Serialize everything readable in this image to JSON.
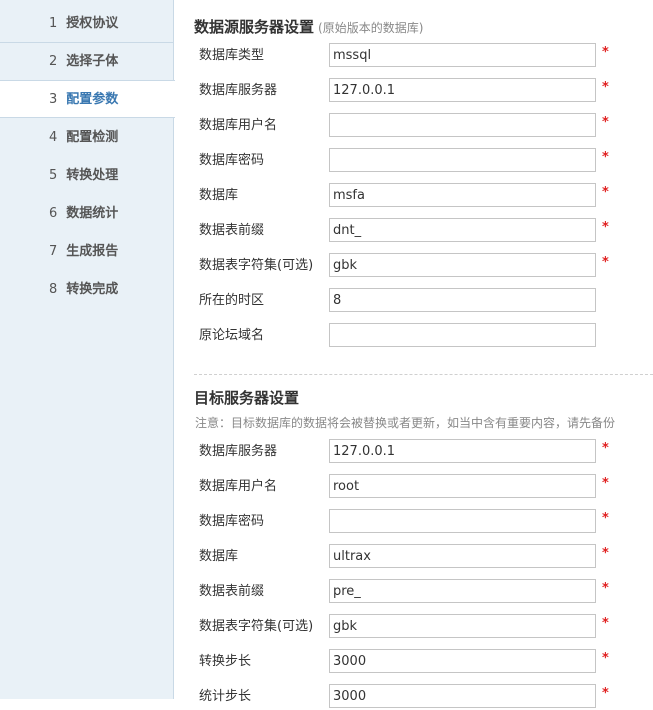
{
  "sidebar": {
    "steps": [
      {
        "num": "1",
        "label": "授权协议"
      },
      {
        "num": "2",
        "label": "选择子体"
      },
      {
        "num": "3",
        "label": "配置参数"
      },
      {
        "num": "4",
        "label": "配置检测"
      },
      {
        "num": "5",
        "label": "转换处理"
      },
      {
        "num": "6",
        "label": "数据统计"
      },
      {
        "num": "7",
        "label": "生成报告"
      },
      {
        "num": "8",
        "label": "转换完成"
      }
    ]
  },
  "source": {
    "title": "数据源服务器设置",
    "subtitle": "(原始版本的数据库)",
    "fields": [
      {
        "label": "数据库类型",
        "value": "mssql",
        "required": "*"
      },
      {
        "label": "数据库服务器",
        "value": "127.0.0.1",
        "required": "*"
      },
      {
        "label": "数据库用户名",
        "value": "",
        "required": "*"
      },
      {
        "label": "数据库密码",
        "value": "",
        "required": "*"
      },
      {
        "label": "数据库",
        "value": "msfa",
        "required": "*"
      },
      {
        "label": "数据表前缀",
        "value": "dnt_",
        "required": "*"
      },
      {
        "label": "数据表字符集(可选)",
        "value": "gbk",
        "required": "*"
      },
      {
        "label": "所在的时区",
        "value": "8",
        "required": ""
      },
      {
        "label": "原论坛域名",
        "value": "",
        "required": ""
      }
    ]
  },
  "target": {
    "title": "目标服务器设置",
    "notice": "注意：目标数据库的数据将会被替换或者更新，如当中含有重要内容，请先备份",
    "fields": [
      {
        "label": "数据库服务器",
        "value": "127.0.0.1",
        "required": "*"
      },
      {
        "label": "数据库用户名",
        "value": "root",
        "required": "*"
      },
      {
        "label": "数据库密码",
        "value": "",
        "required": "*"
      },
      {
        "label": "数据库",
        "value": "ultrax",
        "required": "*"
      },
      {
        "label": "数据表前缀",
        "value": "pre_",
        "required": "*"
      },
      {
        "label": "数据表字符集(可选)",
        "value": "gbk",
        "required": "*"
      },
      {
        "label": "转换步长",
        "value": "3000",
        "required": "*"
      },
      {
        "label": "统计步长",
        "value": "3000",
        "required": "*"
      }
    ]
  }
}
